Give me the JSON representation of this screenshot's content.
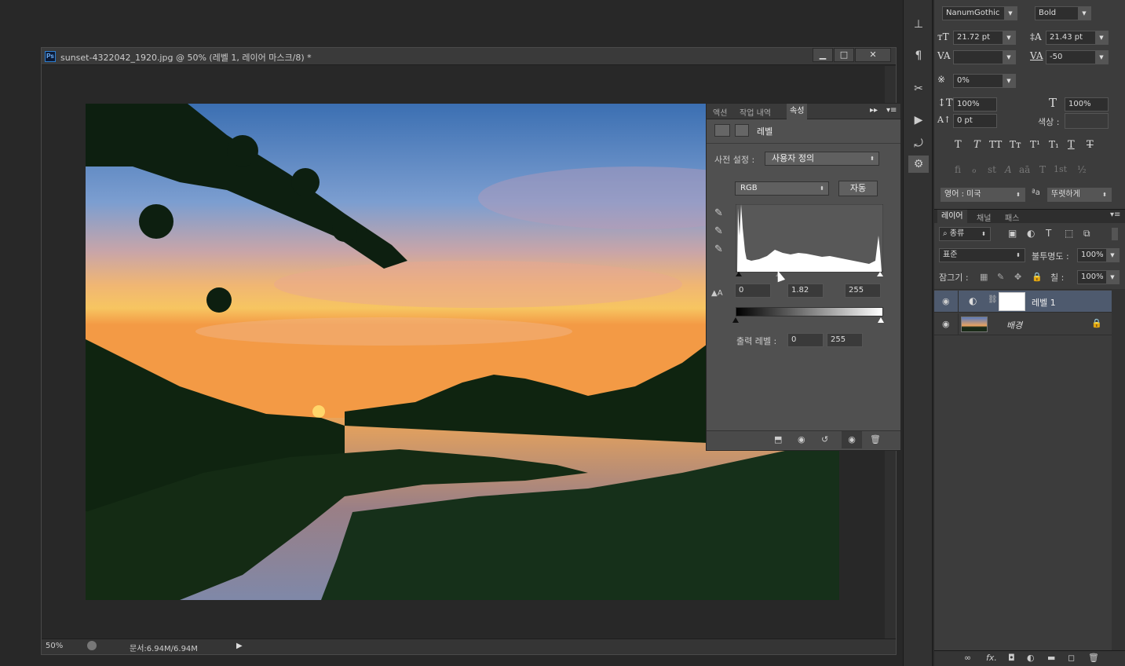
{
  "document": {
    "title": "sunset-4322042_1920.jpg @ 50% (레벨 1, 레이어 마스크/8) *",
    "zoom": "50%",
    "doc_size": "문서:6.94M/6.94M",
    "window_buttons": [
      "▁",
      "□",
      "✕"
    ]
  },
  "properties_panel": {
    "tabs": [
      "액션",
      "작업 내역",
      "속성"
    ],
    "active_tab": "속성",
    "header_title": "레벨",
    "preset_label": "사전 설정 :",
    "preset_value": "사용자 정의",
    "channel_value": "RGB",
    "auto_button": "자동",
    "input_black": "0",
    "input_gamma": "1.82",
    "input_white": "255",
    "output_label": "출력 레벨 :",
    "output_black": "0",
    "output_white": "255"
  },
  "character_panel": {
    "font_family": "NanumGothic",
    "font_style": "Bold",
    "font_size": "21.72 pt",
    "leading": "21.43 pt",
    "kerning": "",
    "tracking": "-50",
    "tsume": "0%",
    "vertical_scale": "100%",
    "horizontal_scale": "100%",
    "baseline_shift": "0 pt",
    "color_label": "색상 :",
    "style_buttons": [
      "T",
      "T",
      "TT",
      "Tт",
      "T¹",
      "T₁",
      "T",
      "T"
    ],
    "opentype_buttons": [
      "fi",
      "ℴ",
      "st",
      "A",
      "aā",
      "T",
      "1st",
      "½"
    ],
    "language": "영어 : 미국",
    "antialias_label": "ªa",
    "antialias": "뚜렷하게"
  },
  "layers_panel": {
    "tabs": [
      "레이어",
      "채널",
      "패스"
    ],
    "filter_kind": "종류",
    "blend_mode": "표준",
    "opacity_label": "불투명도 :",
    "opacity": "100%",
    "lock_label": "잠그기 :",
    "fill_label": "칠 :",
    "fill": "100%",
    "layers": [
      {
        "name": "레벨 1",
        "selected": true
      },
      {
        "name": "배경",
        "selected": false
      }
    ],
    "footer_icons": [
      "link-icon",
      "fx-icon",
      "mask-icon",
      "adjustment-icon",
      "folder-icon",
      "new-layer-icon",
      "trash-icon"
    ]
  },
  "colors": {
    "selected_layer": "#4e5a6e",
    "panel_bg": "#3c3c3c",
    "dark_bg": "#282828"
  }
}
